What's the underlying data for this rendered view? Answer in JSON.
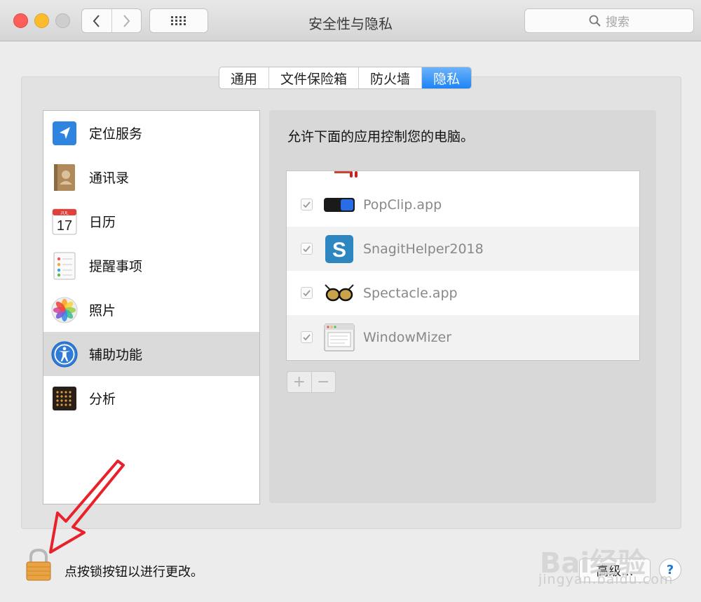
{
  "window": {
    "title": "安全性与隐私"
  },
  "search": {
    "placeholder": "搜索"
  },
  "tabs": [
    {
      "label": "通用"
    },
    {
      "label": "文件保险箱"
    },
    {
      "label": "防火墙"
    },
    {
      "label": "隐私",
      "active": true
    }
  ],
  "sidebar": {
    "items": [
      {
        "label": "定位服务",
        "icon": "location-icon"
      },
      {
        "label": "通讯录",
        "icon": "contacts-icon"
      },
      {
        "label": "日历",
        "icon": "calendar-icon",
        "icon_month": "JUL",
        "icon_day": "17"
      },
      {
        "label": "提醒事项",
        "icon": "reminders-icon"
      },
      {
        "label": "照片",
        "icon": "photos-icon"
      },
      {
        "label": "辅助功能",
        "icon": "accessibility-icon",
        "selected": true
      },
      {
        "label": "分析",
        "icon": "analytics-icon"
      }
    ]
  },
  "content": {
    "description": "允许下面的应用控制您的电脑。",
    "apps": [
      {
        "name": "PopClip.app",
        "checked": true,
        "icon": "popclip-icon"
      },
      {
        "name": "SnagitHelper2018",
        "checked": true,
        "icon": "snagit-icon"
      },
      {
        "name": "Spectacle.app",
        "checked": true,
        "icon": "spectacle-icon"
      },
      {
        "name": "WindowMizer",
        "checked": true,
        "icon": "windowmizer-icon"
      }
    ],
    "add_label": "+",
    "remove_label": "−"
  },
  "footer": {
    "lock_text": "点按锁按钮以进行更改。",
    "advanced_label": "高级...",
    "help_label": "?"
  },
  "watermark": {
    "brand": "Bai经验",
    "url": "jingyan.baidu.com"
  },
  "colors": {
    "accent": "#1c84f6",
    "annotation_arrow": "#e8212b"
  }
}
